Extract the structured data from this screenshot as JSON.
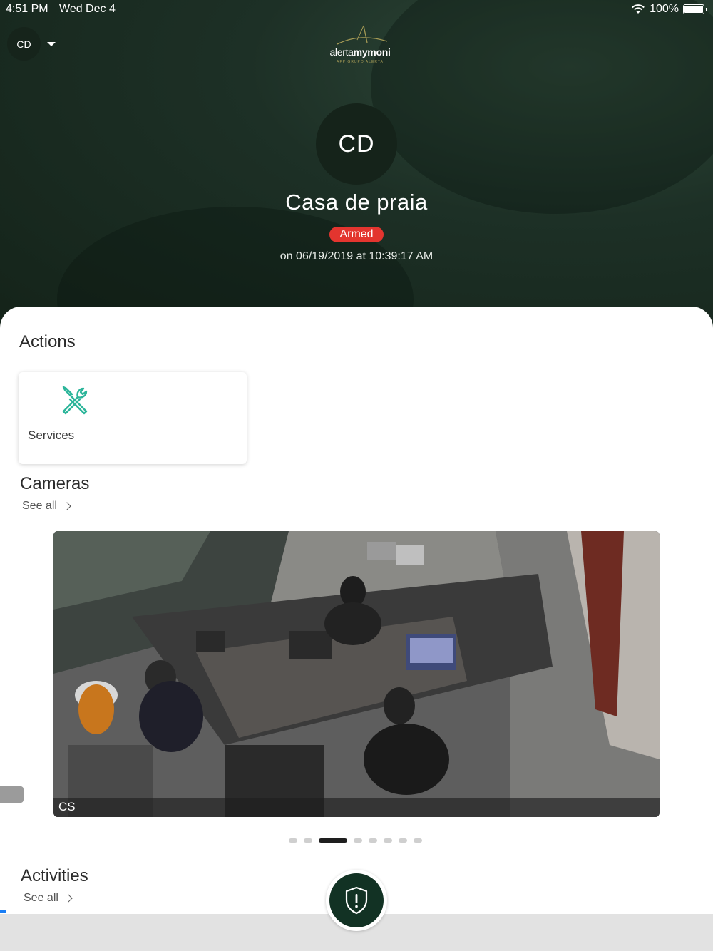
{
  "status_bar": {
    "time": "4:51 PM",
    "date": "Wed Dec 4",
    "battery": "100%"
  },
  "header": {
    "account_initials": "CD",
    "logo": {
      "name_prefix": "alerta",
      "name_suffix": "mymoni",
      "tagline": "APP GRUPO ALERTA"
    },
    "avatar_initials": "CD",
    "site_name": "Casa de praia",
    "status_badge": "Armed",
    "status_colors": {
      "armed": "#e3352f"
    },
    "armed_time": "on 06/19/2019 at 10:39:17 AM"
  },
  "actions": {
    "title": "Actions",
    "items": [
      {
        "label": "Services",
        "icon": "tools-icon",
        "color": "#2cb59a"
      }
    ]
  },
  "cameras": {
    "title": "Cameras",
    "see_all": "See all",
    "current": {
      "name": "CS"
    },
    "pager": {
      "count": 9,
      "active_index": 2
    }
  },
  "activities": {
    "title": "Activities",
    "see_all": "See all"
  },
  "panic_button": {
    "icon": "shield-alert-icon"
  }
}
